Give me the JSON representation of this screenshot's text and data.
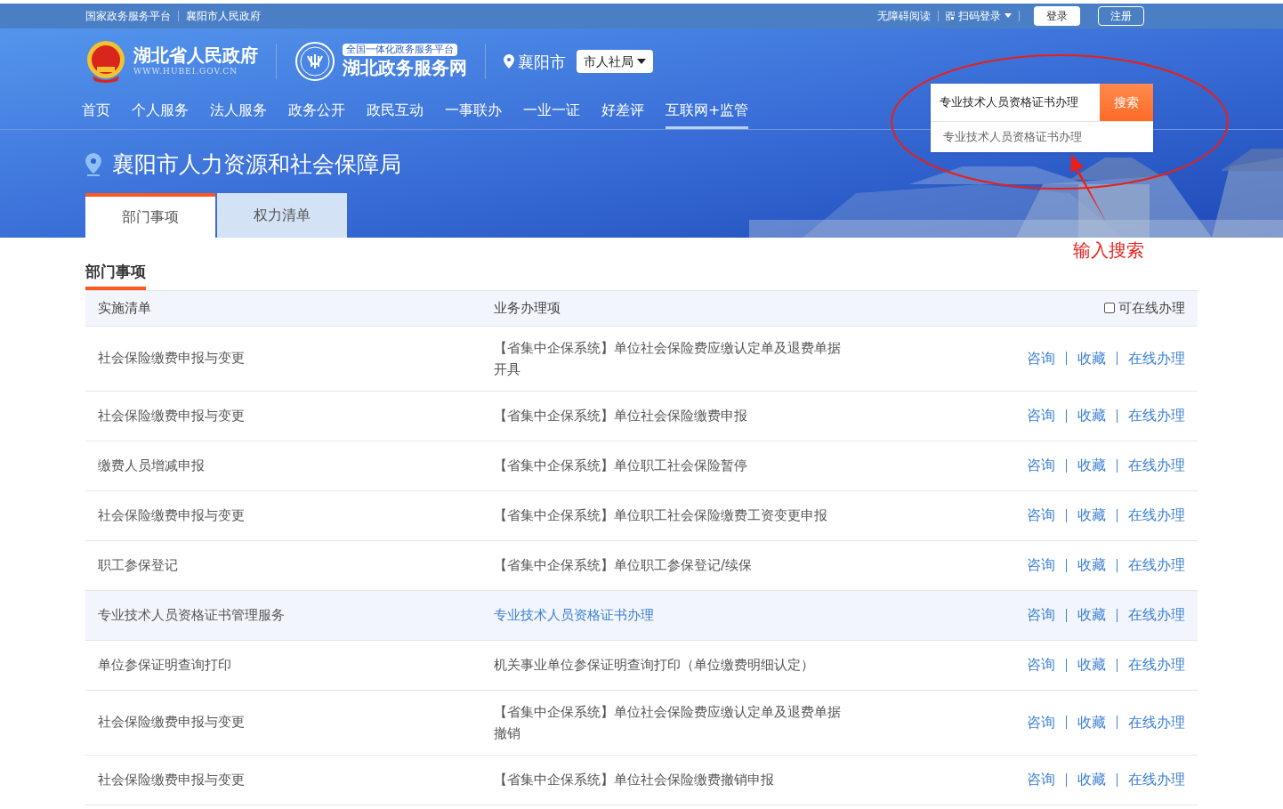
{
  "top_bar": {
    "left_links": [
      "国家政务服务平台",
      "襄阳市人民政府"
    ],
    "accessibility": "无障碍阅读",
    "qr_login": "扫码登录",
    "login": "登录",
    "register": "注册"
  },
  "header": {
    "gov_name": "湖北省人民政府",
    "gov_url": "WWW.HUBEI.GOV.CN",
    "platform_tag": "全国一体化政务服务平台",
    "platform_name": "湖北政务服务网",
    "city": "襄阳市",
    "department": "市人社局"
  },
  "nav": [
    {
      "label": "首页",
      "selected": false
    },
    {
      "label": "个人服务",
      "selected": false
    },
    {
      "label": "法人服务",
      "selected": false
    },
    {
      "label": "政务公开",
      "selected": false
    },
    {
      "label": "政民互动",
      "selected": false
    },
    {
      "label": "一事联办",
      "selected": false
    },
    {
      "label": "一业一证",
      "selected": false
    },
    {
      "label": "好差评",
      "selected": false
    },
    {
      "label": "互联网+监管",
      "selected": true
    }
  ],
  "search": {
    "value": "专业技术人员资格证书办理",
    "button": "搜索",
    "suggestions": [
      "专业技术人员资格证书办理"
    ]
  },
  "annotation": {
    "text": "输入搜索"
  },
  "page_title": "襄阳市人力资源和社会保障局",
  "tabs": [
    {
      "label": "部门事项",
      "selected": true
    },
    {
      "label": "权力清单",
      "selected": false
    }
  ],
  "section_title": "部门事项",
  "table": {
    "columns": [
      "实施清单",
      "业务办理项"
    ],
    "online_filter": {
      "label": "可在线办理",
      "checked": false
    },
    "rows": [
      {
        "item": "社会保险缴费申报与变更",
        "service": "【省集中企保系统】单位社会保险费应缴认定单及退费单据开具",
        "actions": [
          "咨询",
          "收藏",
          "在线办理"
        ],
        "highlighted": false
      },
      {
        "item": "社会保险缴费申报与变更",
        "service": "【省集中企保系统】单位社会保险缴费申报",
        "actions": [
          "咨询",
          "收藏",
          "在线办理"
        ],
        "highlighted": false
      },
      {
        "item": "缴费人员增减申报",
        "service": "【省集中企保系统】单位职工社会保险暂停",
        "actions": [
          "咨询",
          "收藏",
          "在线办理"
        ],
        "highlighted": false
      },
      {
        "item": "社会保险缴费申报与变更",
        "service": "【省集中企保系统】单位职工社会保险缴费工资变更申报",
        "actions": [
          "咨询",
          "收藏",
          "在线办理"
        ],
        "highlighted": false
      },
      {
        "item": "职工参保登记",
        "service": "【省集中企保系统】单位职工参保登记/续保",
        "actions": [
          "咨询",
          "收藏",
          "在线办理"
        ],
        "highlighted": false
      },
      {
        "item": "专业技术人员资格证书管理服务",
        "service": "专业技术人员资格证书办理",
        "actions": [
          "咨询",
          "收藏",
          "在线办理"
        ],
        "highlighted": true
      },
      {
        "item": "单位参保证明查询打印",
        "service": "机关事业单位参保证明查询打印（单位缴费明细认定）",
        "actions": [
          "咨询",
          "收藏",
          "在线办理"
        ],
        "highlighted": false
      },
      {
        "item": "社会保险缴费申报与变更",
        "service": "【省集中企保系统】单位社会保险费应缴认定单及退费单据撤销",
        "actions": [
          "咨询",
          "收藏",
          "在线办理"
        ],
        "highlighted": false
      },
      {
        "item": "社会保险缴费申报与变更",
        "service": "【省集中企保系统】单位社会保险缴费撤销申报",
        "actions": [
          "咨询",
          "收藏",
          "在线办理"
        ],
        "highlighted": false
      }
    ]
  }
}
